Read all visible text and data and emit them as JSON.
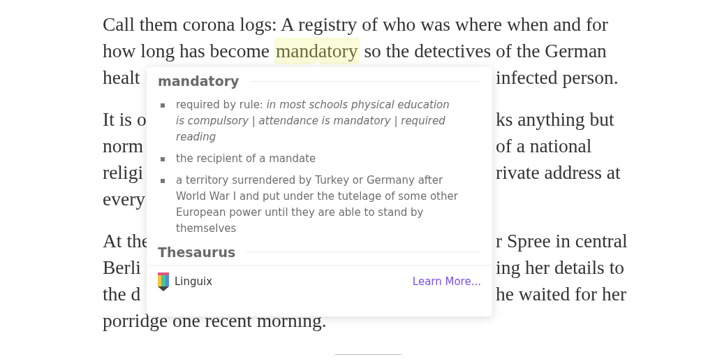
{
  "article": {
    "paragraphs": [
      {
        "lines": [
          {
            "kind": "full",
            "segments": [
              {
                "text": "Call them corona logs: A registry of who was where when and for",
                "highlighted": false
              }
            ]
          },
          {
            "kind": "full",
            "segments": [
              {
                "text": "how long has become ",
                "highlighted": false
              },
              {
                "text": "mandatory",
                "highlighted": true
              },
              {
                "text": " so the detectives of the German",
                "highlighted": false
              }
            ]
          },
          {
            "kind": "split",
            "left": "healt",
            "right": "infected person."
          }
        ]
      },
      {
        "lines": [
          {
            "kind": "split",
            "left": "It is o",
            "right": "ks anything but"
          },
          {
            "kind": "split",
            "left": "norm",
            "right": "of a national"
          },
          {
            "kind": "split",
            "left": "religi",
            "right": "rivate address at"
          },
          {
            "kind": "split",
            "left": "every"
          }
        ]
      },
      {
        "lines": [
          {
            "kind": "split",
            "left": "At the",
            "right": "r Spree in central"
          },
          {
            "kind": "split",
            "left": "Berli",
            "right": "ing her details to"
          },
          {
            "kind": "split",
            "left": "the d",
            "right": "he waited for her"
          },
          {
            "kind": "full",
            "segments": [
              {
                "text": "porridge one recent morning.",
                "highlighted": false
              }
            ]
          }
        ]
      }
    ]
  },
  "popup": {
    "word": "mandatory",
    "definitions": [
      "required by rule: *in most schools physical education is compulsory | attendance is mandatory | required reading*",
      "the recipient of a mandate",
      "a territory surrendered by Turkey or Germany after World War I and put under the tutelage of some other European power until they are able to stand by themselves"
    ],
    "section": "Thesaurus",
    "brand": "Linguix",
    "link": "Learn More..."
  }
}
